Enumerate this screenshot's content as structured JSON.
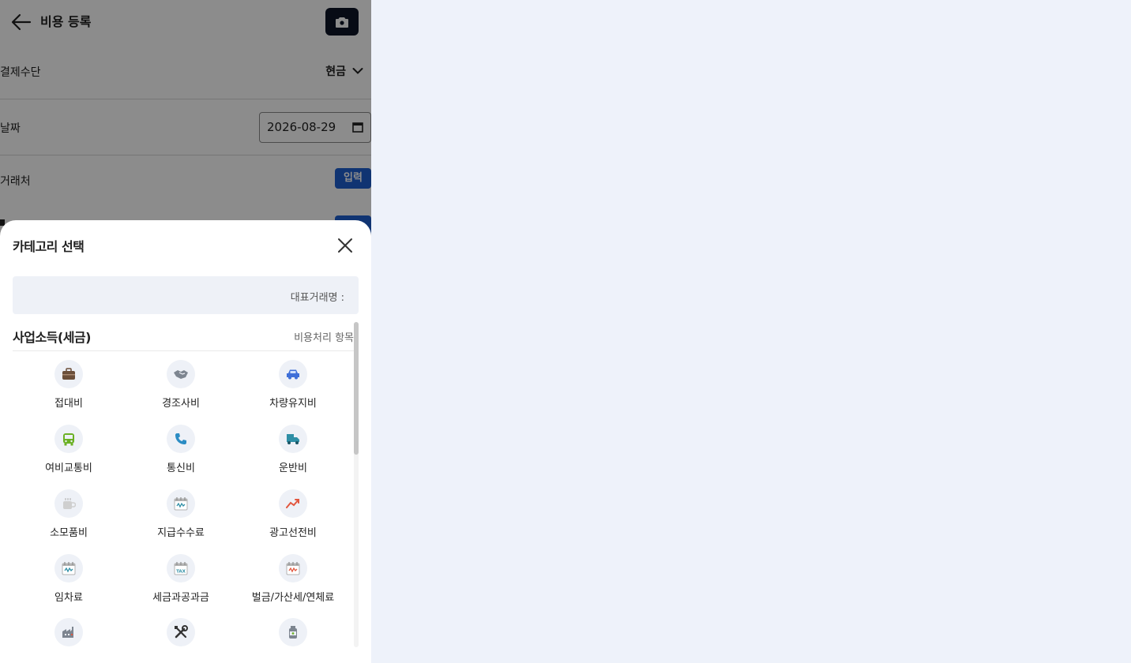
{
  "header": {
    "title": "비용 등록"
  },
  "form": {
    "payment_label": "결제수단",
    "payment_value": "현금",
    "date_label": "날짜",
    "date_value": "2026-08-29",
    "vendor_label": "거래처",
    "vendor_button": "입력"
  },
  "sheet": {
    "title": "카테고리 선택",
    "rep_label": "대표거래명 :",
    "section_title": "사업소득(세금)",
    "section_right": "비용처리 항목",
    "categories": [
      {
        "label": "접대비",
        "icon": "briefcase-icon"
      },
      {
        "label": "경조사비",
        "icon": "handshake-icon"
      },
      {
        "label": "차량유지비",
        "icon": "car-icon"
      },
      {
        "label": "여비교통비",
        "icon": "bus-icon"
      },
      {
        "label": "통신비",
        "icon": "phone-icon"
      },
      {
        "label": "운반비",
        "icon": "truck-icon"
      },
      {
        "label": "소모품비",
        "icon": "coffee-icon"
      },
      {
        "label": "지급수수료",
        "icon": "receipt-icon"
      },
      {
        "label": "광고선전비",
        "icon": "trend-up-icon"
      },
      {
        "label": "임차료",
        "icon": "calendar-icon"
      },
      {
        "label": "세금과공과금",
        "icon": "tax-icon"
      },
      {
        "label": "벌금/가산세/연체료",
        "icon": "penalty-icon"
      },
      {
        "label": "",
        "icon": "factory-icon"
      },
      {
        "label": "",
        "icon": "tools-icon"
      },
      {
        "label": "",
        "icon": "bottle-icon"
      }
    ]
  },
  "colors": {
    "accent": "#1e5fd0",
    "camera_bg": "#0d1527",
    "chip_bg": "#eef1f7"
  }
}
